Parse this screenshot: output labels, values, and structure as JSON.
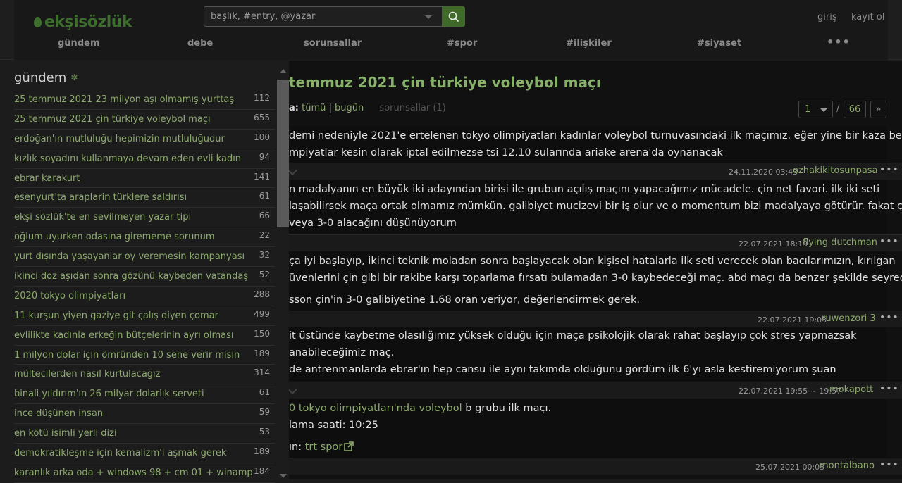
{
  "header": {
    "logo": "ekşisözlük",
    "search_placeholder": "başlık, #entry, @yazar",
    "login": "giriş",
    "register": "kayıt ol",
    "nav": [
      "gündem",
      "debe",
      "sorunsallar",
      "#spor",
      "#ilişkiler",
      "#siyaset",
      "•••"
    ]
  },
  "sidebar": {
    "title": "gündem",
    "topics": [
      {
        "title": "25 temmuz 2021 23 milyon aşı olmamış yurttaş",
        "count": "112"
      },
      {
        "title": "25 temmuz 2021 çin türkiye voleybol maçı",
        "count": "655"
      },
      {
        "title": "erdoğan'ın mutluluğu hepimizin mutluluğudur",
        "count": "100"
      },
      {
        "title": "kızlık soyadını kullanmaya devam eden evli kadın",
        "count": "94"
      },
      {
        "title": "ebrar karakurt",
        "count": "141"
      },
      {
        "title": "esenyurt'ta araplarin türklere saldırısı",
        "count": "61"
      },
      {
        "title": "ekşi sözlük'te en sevilmeyen yazar tipi",
        "count": "66"
      },
      {
        "title": "oğlum uyurken odasına girememe sorunum",
        "count": "22"
      },
      {
        "title": "yurt dışında yaşayanlar oy veremesin kampanyası",
        "count": "32"
      },
      {
        "title": "ikinci doz aşıdan sonra gözünü kaybeden vatandaş",
        "count": "52"
      },
      {
        "title": "2020 tokyo olimpiyatları",
        "count": "288"
      },
      {
        "title": "11 kurşun yiyen gaziye git çalış diyen çomar",
        "count": "499"
      },
      {
        "title": "evlilikte kadınla erkeğin bütçelerinin ayrı olması",
        "count": "150"
      },
      {
        "title": "1 milyon dolar için ömründen 10 sene verir misin",
        "count": "189"
      },
      {
        "title": "mültecilerden nasıl kurtulacağız",
        "count": "314"
      },
      {
        "title": "binali yıldırım'ın 26 milyar dolarlık serveti",
        "count": "61"
      },
      {
        "title": "ince düşünen insan",
        "count": "59"
      },
      {
        "title": "en kötü isimli yerli dizi",
        "count": "53"
      },
      {
        "title": "demokratikleşme için kemalizm'i aşmak gerek",
        "count": "189"
      },
      {
        "title": "karanlık arka oda + windows 98 + cm 01 + winamp",
        "count": "184"
      }
    ]
  },
  "main": {
    "title": "temmuz 2021 çin türkiye voleybol maçı",
    "sub_label": "a:",
    "sub_all": "tümü",
    "sub_sep": "|",
    "sub_today": "bugün",
    "sub_qa": "sorunsallar (1)",
    "page_current": "1",
    "page_slash": "/",
    "page_total": "66",
    "page_next": "»",
    "entries": [
      {
        "lines": [
          "demi nedeniyle 2021'e ertelenen tokyo olimpiyatları kadınlar voleybol turnuvasındaki ilk maçımız. eğer yine bir kaza bela olup",
          "mpiyatlar kesin olarak iptal edilmezse tsi 12.10 sularında ariake arena'da oynanacak"
        ],
        "date": "24.11.2020 03:43",
        "author": "ozhakikitosunpasa"
      },
      {
        "lines": [
          "n madalyanın en büyük iki adayından birisi ile grubun açılış maçını yapacağımız mücadele. çin net favori. ilk iki seti",
          "laşabilirsek maça ortak olmamız mümkün. galibiyet mucizevi bir iş olur ve o momentum bizi madalyaya götürür. fakat çin'in",
          "veya 3-0 alacağını düşünüyorum"
        ],
        "date": "22.07.2021 18:19",
        "author": "flying dutchman"
      },
      {
        "lines": [
          "ça iyi başlayıp, ikinci teknik moladan sonra başlayacak olan kişisel hatalarla ilk seti verecek olan bacılarımızın, kırılgan",
          "üvenlerini çin gibi bir rakibe karşı toparlama fırsatı bulamadan 3-0 kaybedeceği maç. abd maçı da benzer şekilde seyredecektir.",
          "",
          "sson çin'in 3-0 galibiyetine 1.68 oran veriyor, değerlendirmek gerek."
        ],
        "date": "22.07.2021 19:03",
        "author": "ruwenzori 3"
      },
      {
        "lines": [
          "it üstünde kaybetme olasılığımız yüksek olduğu için maça psikolojik olarak rahat başlayıp çok stres yapmazsak",
          "anabileceğimiz maç.",
          "de antrenmanlarda ebrar'ın hep cansu ile aynı takımda olduğunu gördüm ilk 6'yı asla kestiremiyorum şuan"
        ],
        "date": "22.07.2021 19:55 ~ 19:57",
        "author": "mokapott"
      },
      {
        "link1": "0 tokyo olimpiyatları'nda voleybol",
        "text1": " b grubu ilk maçı.",
        "line2": "lama saati: 10:25",
        "label3": "ın: ",
        "link3": "trt spor",
        "date": "25.07.2021 00:03",
        "author": "montalbano"
      }
    ]
  },
  "colors": {
    "accent": "#87b06a",
    "link": "#8daa6d",
    "brand": "#3d6e2e"
  }
}
